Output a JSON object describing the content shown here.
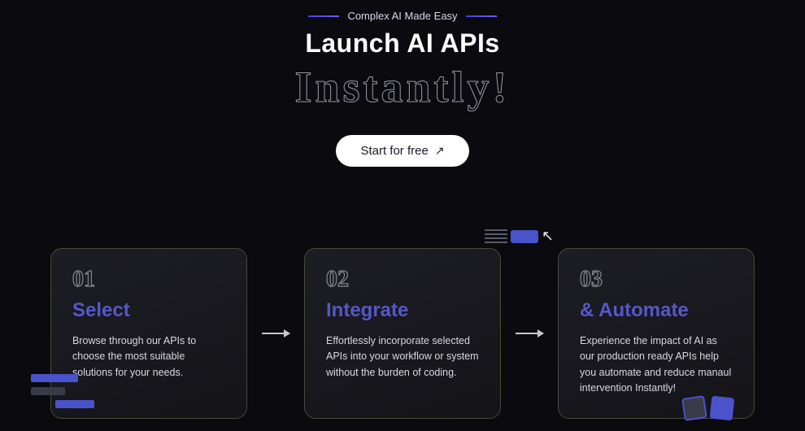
{
  "hero": {
    "tagline": "Complex AI Made Easy",
    "headline": "Launch AI APIs",
    "headline_sub": "Instantly!",
    "cta_label": "Start for free",
    "cta_arrow": "↗"
  },
  "cards": [
    {
      "number": "01",
      "title": "Select",
      "desc": "Browse through our APIs to choose the most suitable solutions for your needs."
    },
    {
      "number": "02",
      "title": "Integrate",
      "desc": "Effortlessly incorporate selected APIs into your workflow or system without the burden of coding."
    },
    {
      "number": "03",
      "title": "& Automate",
      "desc": "Experience the impact of AI as our production ready APIs help you automate and reduce manaul intervention Instantly!"
    }
  ]
}
